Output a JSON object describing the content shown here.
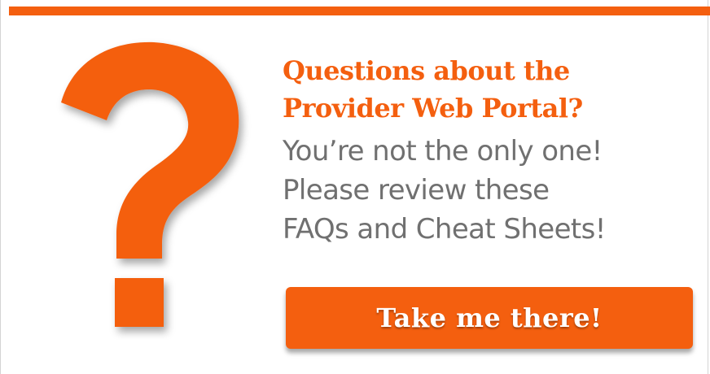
{
  "promo": {
    "icon": "question-mark-icon",
    "accent_color": "#f45f0f",
    "headline_lines": [
      "Questions about the",
      "Provider Web Portal?"
    ],
    "body_lines": [
      "You’re not the only one!",
      "Please review these",
      "FAQs and Cheat Sheets!"
    ],
    "cta_label": "Take me there!"
  }
}
